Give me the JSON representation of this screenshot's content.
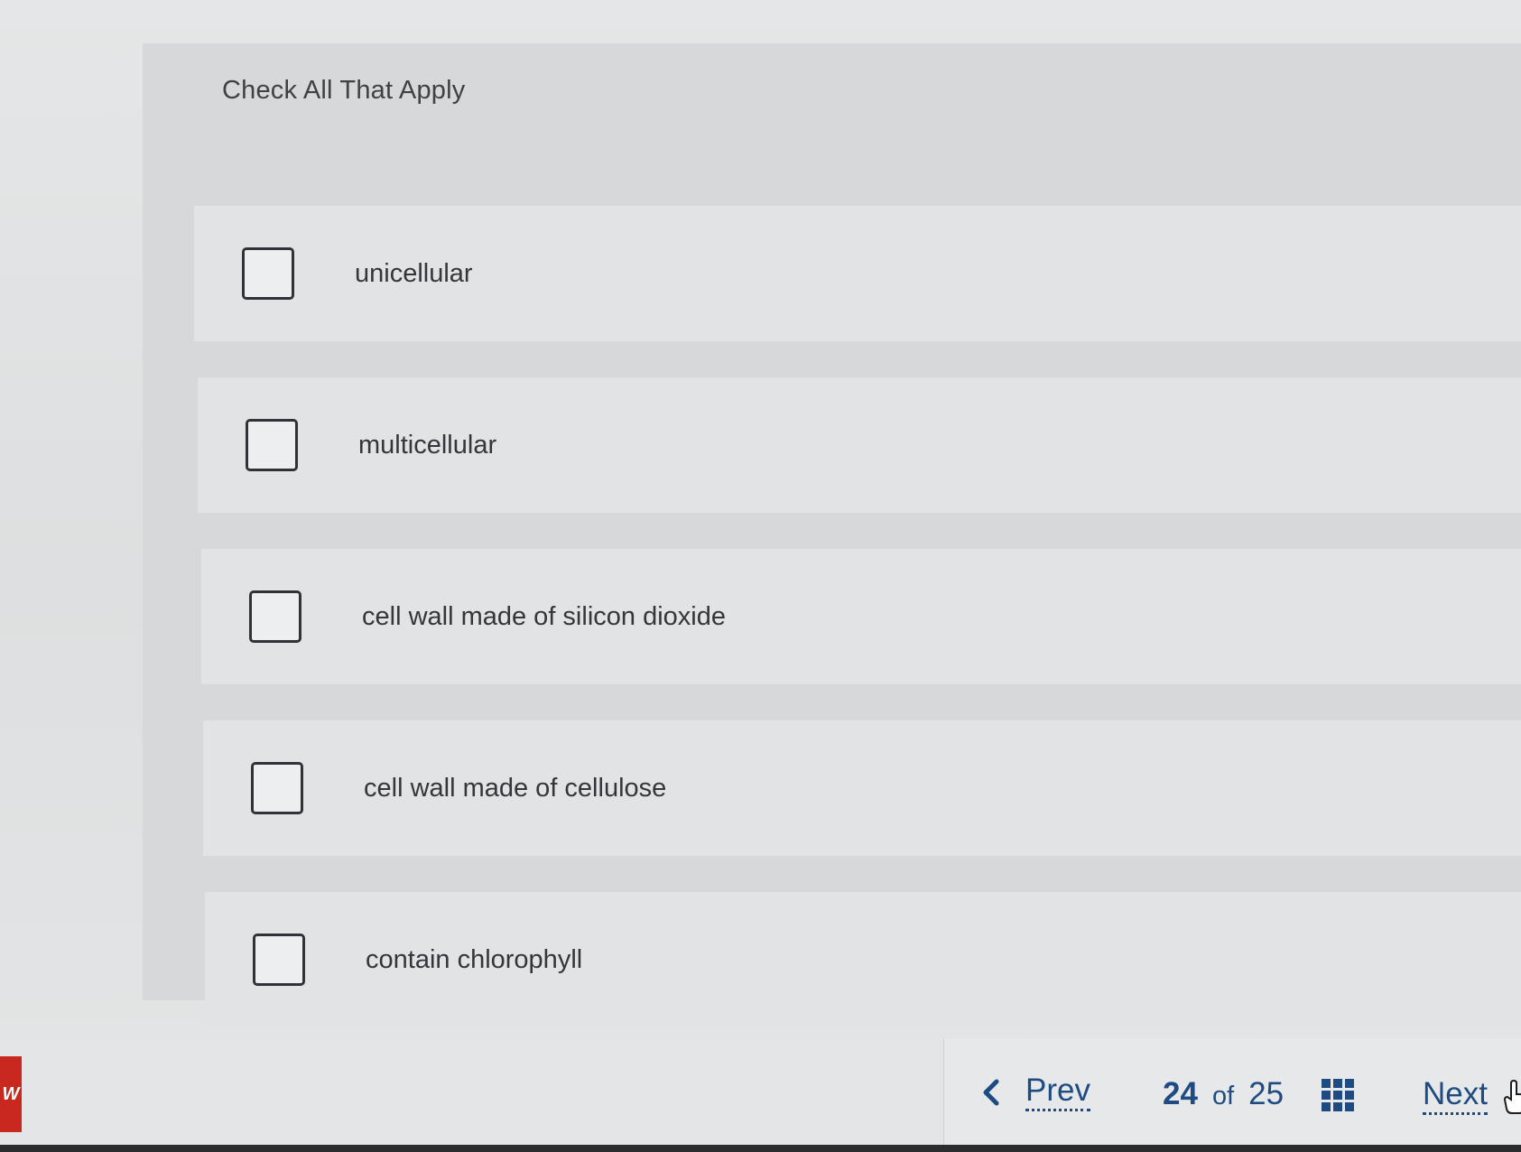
{
  "question": {
    "instruction": "Check All That Apply",
    "options": [
      {
        "label": "unicellular",
        "checked": false
      },
      {
        "label": "multicellular",
        "checked": false
      },
      {
        "label": "cell wall made of silicon dioxide",
        "checked": false
      },
      {
        "label": "cell wall made of cellulose",
        "checked": false
      },
      {
        "label": "contain chlorophyll",
        "checked": false
      }
    ]
  },
  "navigation": {
    "prev_label": "Prev",
    "current_page": "24",
    "of_label": "of",
    "total_pages": "25",
    "next_label": "Next",
    "accent_color": "#1f4b83"
  },
  "brand": {
    "badge_text": "W",
    "badge_color": "#c8281e"
  },
  "icons": {
    "prev": "chevron-left-icon",
    "grid": "grid-icon",
    "cursor": "hand-cursor-icon"
  }
}
